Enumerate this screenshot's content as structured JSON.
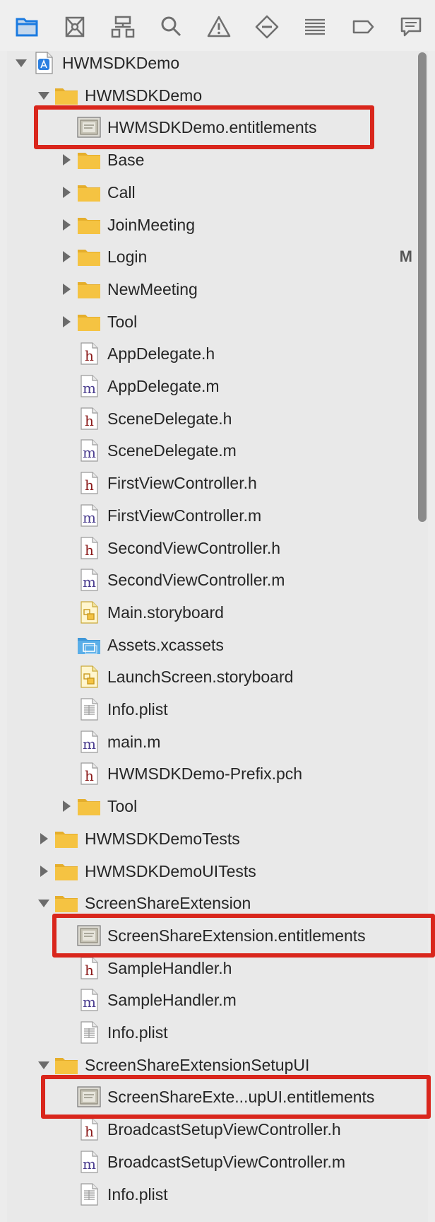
{
  "toolbar": {
    "icons": [
      {
        "name": "project-navigator-icon",
        "selected": true
      },
      {
        "name": "source-control-icon",
        "selected": false
      },
      {
        "name": "symbol-navigator-icon",
        "selected": false
      },
      {
        "name": "find-icon",
        "selected": false
      },
      {
        "name": "issue-warning-icon",
        "selected": false
      },
      {
        "name": "test-diamond-icon",
        "selected": false
      },
      {
        "name": "debug-list-icon",
        "selected": false
      },
      {
        "name": "breakpoint-icon",
        "selected": false
      },
      {
        "name": "report-icon",
        "selected": false
      }
    ],
    "accent": "#1a7ae0"
  },
  "tree": {
    "items": [
      {
        "label": "HWMSDKDemo",
        "type": "project",
        "level": 0,
        "disclosure": "open"
      },
      {
        "label": "HWMSDKDemo",
        "type": "folder",
        "level": 1,
        "disclosure": "open"
      },
      {
        "label": "HWMSDKDemo.entitlements",
        "type": "entitlements",
        "level": 2,
        "disclosure": "none"
      },
      {
        "label": "Base",
        "type": "folder",
        "level": 2,
        "disclosure": "closed"
      },
      {
        "label": "Call",
        "type": "folder",
        "level": 2,
        "disclosure": "closed"
      },
      {
        "label": "JoinMeeting",
        "type": "folder",
        "level": 2,
        "disclosure": "closed"
      },
      {
        "label": "Login",
        "type": "folder",
        "level": 2,
        "disclosure": "closed",
        "badge": "M"
      },
      {
        "label": "NewMeeting",
        "type": "folder",
        "level": 2,
        "disclosure": "closed"
      },
      {
        "label": "Tool",
        "type": "folder",
        "level": 2,
        "disclosure": "closed"
      },
      {
        "label": "AppDelegate.h",
        "type": "h",
        "level": 2,
        "disclosure": "none"
      },
      {
        "label": "AppDelegate.m",
        "type": "m",
        "level": 2,
        "disclosure": "none"
      },
      {
        "label": "SceneDelegate.h",
        "type": "h",
        "level": 2,
        "disclosure": "none"
      },
      {
        "label": "SceneDelegate.m",
        "type": "m",
        "level": 2,
        "disclosure": "none"
      },
      {
        "label": "FirstViewController.h",
        "type": "h",
        "level": 2,
        "disclosure": "none"
      },
      {
        "label": "FirstViewController.m",
        "type": "m",
        "level": 2,
        "disclosure": "none"
      },
      {
        "label": "SecondViewController.h",
        "type": "h",
        "level": 2,
        "disclosure": "none"
      },
      {
        "label": "SecondViewController.m",
        "type": "m",
        "level": 2,
        "disclosure": "none"
      },
      {
        "label": "Main.storyboard",
        "type": "storyboard",
        "level": 2,
        "disclosure": "none"
      },
      {
        "label": "Assets.xcassets",
        "type": "assets",
        "level": 2,
        "disclosure": "none"
      },
      {
        "label": "LaunchScreen.storyboard",
        "type": "storyboard",
        "level": 2,
        "disclosure": "none"
      },
      {
        "label": "Info.plist",
        "type": "plist",
        "level": 2,
        "disclosure": "none"
      },
      {
        "label": "main.m",
        "type": "m",
        "level": 2,
        "disclosure": "none"
      },
      {
        "label": "HWMSDKDemo-Prefix.pch",
        "type": "h",
        "level": 2,
        "disclosure": "none"
      },
      {
        "label": "Tool",
        "type": "folder",
        "level": 2,
        "disclosure": "closed"
      },
      {
        "label": "HWMSDKDemoTests",
        "type": "folder",
        "level": 1,
        "disclosure": "closed"
      },
      {
        "label": "HWMSDKDemoUITests",
        "type": "folder",
        "level": 1,
        "disclosure": "closed"
      },
      {
        "label": "ScreenShareExtension",
        "type": "folder",
        "level": 1,
        "disclosure": "open"
      },
      {
        "label": "ScreenShareExtension.entitlements",
        "type": "entitlements",
        "level": 2,
        "disclosure": "none"
      },
      {
        "label": "SampleHandler.h",
        "type": "h",
        "level": 2,
        "disclosure": "none"
      },
      {
        "label": "SampleHandler.m",
        "type": "m",
        "level": 2,
        "disclosure": "none"
      },
      {
        "label": "Info.plist",
        "type": "plist",
        "level": 2,
        "disclosure": "none"
      },
      {
        "label": "ScreenShareExtensionSetupUI",
        "type": "folder",
        "level": 1,
        "disclosure": "open"
      },
      {
        "label": "ScreenShareExte...upUI.entitlements",
        "type": "entitlements",
        "level": 2,
        "disclosure": "none"
      },
      {
        "label": "BroadcastSetupViewController.h",
        "type": "h",
        "level": 2,
        "disclosure": "none"
      },
      {
        "label": "BroadcastSetupViewController.m",
        "type": "m",
        "level": 2,
        "disclosure": "none"
      },
      {
        "label": "Info.plist",
        "type": "plist",
        "level": 2,
        "disclosure": "none"
      }
    ]
  },
  "highlight_color": "#d9261c",
  "colors": {
    "folder": "#f5c342",
    "h_letter": "#8b1a1a",
    "m_letter": "#4b3d8f",
    "assets": "#5aaee8"
  }
}
